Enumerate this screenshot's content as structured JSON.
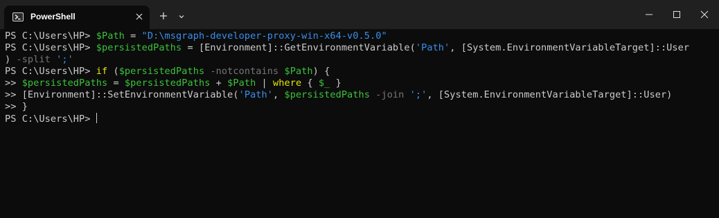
{
  "window": {
    "tab_title": "PowerShell",
    "icons": {
      "tab": "powershell-icon",
      "tab_close": "close-icon",
      "new_tab": "plus-icon",
      "dropdown": "chevron-down-icon",
      "minimize": "minimize-icon",
      "maximize": "maximize-icon",
      "close": "close-icon"
    }
  },
  "colors": {
    "background": "#0c0c0c",
    "titlebar": "#202020",
    "text": "#cccccc",
    "variable": "#3bc23b",
    "string": "#3b8eea",
    "keyword": "#e5e510",
    "operator": "#767676"
  },
  "terminal": {
    "prompt": "PS C:\\Users\\HP> ",
    "continuation": ">> ",
    "l1": {
      "var": "$Path",
      "eq": " = ",
      "str": "\"D:\\msgraph-developer-proxy-win-x64-v0.5.0\""
    },
    "l2": {
      "var": "$persistedPaths",
      "eq": " = ",
      "t1": "[Environment]::GetEnvironmentVariable(",
      "s1": "'Path'",
      "t2": ", [System.EnvironmentVariableTarget]::User"
    },
    "l3": {
      "t1": ") ",
      "op": "-split",
      "sp": " ",
      "s1": "';'"
    },
    "l4": {
      "kw": "if",
      "t1": " (",
      "var1": "$persistedPaths",
      "sp": " ",
      "op": "-notcontains",
      "sp2": " ",
      "var2": "$Path",
      "t2": ") {"
    },
    "l5": {
      "var1": "$persistedPaths",
      "eq": " = ",
      "var2": "$persistedPaths",
      "plus": " + ",
      "var3": "$Path",
      "pipe": " | ",
      "kw": "where",
      "t1": " { ",
      "var4": "$_",
      "t2": " }"
    },
    "l6": {
      "t1": "[Environment]::SetEnvironmentVariable(",
      "s1": "'Path'",
      "t2": ", ",
      "var": "$persistedPaths",
      "sp": " ",
      "op": "-join",
      "sp2": " ",
      "s2": "';'",
      "t3": ", [System.EnvironmentVariableTarget]::User)"
    },
    "l7": {
      "t1": "}"
    }
  }
}
